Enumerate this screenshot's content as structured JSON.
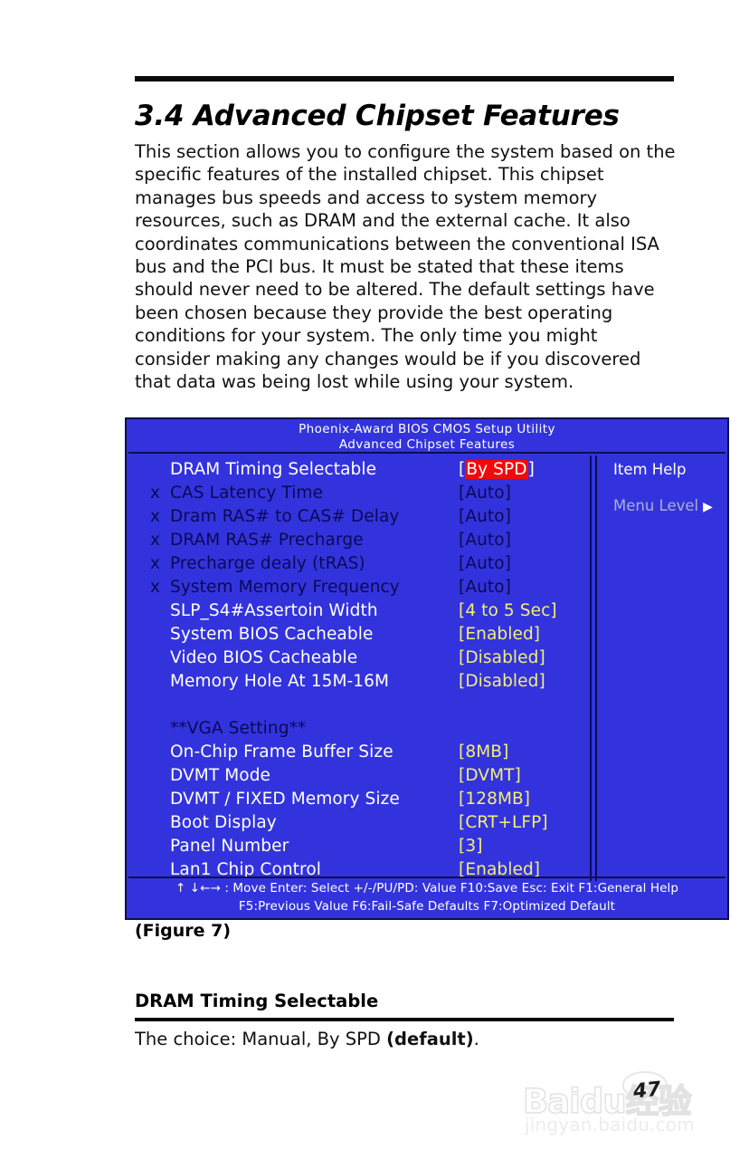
{
  "document": {
    "title": "3.4 Advanced Chipset Features",
    "intro": "This section allows you to configure the system based on the specific features of the installed chipset. This chipset manages bus speeds and access to system memory resources, such as DRAM and the external cache.  It also coordinates communications between the conventional ISA bus and the PCI bus. It must be stated that these items should never need to be altered. The default settings have been chosen because they provide the best operating conditions for your system. The only time you might consider making any changes would be if you discovered that data was being lost while using your system.",
    "figure_caption": "(Figure 7)",
    "page_number": "47"
  },
  "bios": {
    "title_line1": "Phoenix-Award BIOS CMOS Setup Utility",
    "title_line2": "Advanced Chipset Features",
    "rows": [
      {
        "mark": "",
        "label": "DRAM  Timing  Selectable",
        "value_prefix": "[",
        "value": "By SPD",
        "value_suffix": "]",
        "highlight": true,
        "dim": false,
        "section": false
      },
      {
        "mark": "x",
        "label": "CAS  Latency Time",
        "value_prefix": "[",
        "value": "Auto",
        "value_suffix": "]",
        "highlight": false,
        "dim": true,
        "section": false
      },
      {
        "mark": "x",
        "label": "Dram RAS#  to CAS# Delay",
        "value_prefix": "[",
        "value": "Auto",
        "value_suffix": "]",
        "highlight": false,
        "dim": true,
        "section": false
      },
      {
        "mark": "x",
        "label": "DRAM  RAS#  Precharge",
        "value_prefix": "[",
        "value": "Auto",
        "value_suffix": "]",
        "highlight": false,
        "dim": true,
        "section": false
      },
      {
        "mark": "x",
        "label": "Precharge  dealy (tRAS)",
        "value_prefix": "[",
        "value": "Auto",
        "value_suffix": "]",
        "highlight": false,
        "dim": true,
        "section": false
      },
      {
        "mark": "x",
        "label": "System Memory Frequency",
        "value_prefix": "[",
        "value": "Auto",
        "value_suffix": "]",
        "highlight": false,
        "dim": true,
        "section": false
      },
      {
        "mark": "",
        "label": "SLP_S4#Assertoin Width",
        "value_prefix": "[",
        "value": "4 to 5 Sec",
        "value_suffix": "]",
        "highlight": false,
        "dim": false,
        "section": false
      },
      {
        "mark": "",
        "label": "System  BIOS Cacheable",
        "value_prefix": "[",
        "value": "Enabled",
        "value_suffix": "]",
        "highlight": false,
        "dim": false,
        "section": false
      },
      {
        "mark": "",
        "label": "Video  BIOS Cacheable",
        "value_prefix": "[",
        "value": "Disabled",
        "value_suffix": "]",
        "highlight": false,
        "dim": false,
        "section": false
      },
      {
        "mark": "",
        "label": "Memory  Hole At 15M-16M",
        "value_prefix": "[",
        "value": "Disabled",
        "value_suffix": "]",
        "highlight": false,
        "dim": false,
        "section": false
      },
      {
        "mark": "",
        "label": "",
        "value_prefix": "",
        "value": "",
        "value_suffix": "",
        "highlight": false,
        "dim": false,
        "section": false
      },
      {
        "mark": "",
        "label": "**VGA Setting**",
        "value_prefix": "",
        "value": "",
        "value_suffix": "",
        "highlight": false,
        "dim": false,
        "section": true
      },
      {
        "mark": "",
        "label": "On-Chip Frame Buffer Size",
        "value_prefix": "[",
        "value": "8MB",
        "value_suffix": "]",
        "highlight": false,
        "dim": false,
        "section": false
      },
      {
        "mark": "",
        "label": "DVMT  Mode",
        "value_prefix": "[",
        "value": "DVMT",
        "value_suffix": "]",
        "highlight": false,
        "dim": false,
        "section": false
      },
      {
        "mark": "",
        "label": "DVMT / FIXED Memory Size",
        "value_prefix": "[",
        "value": "128MB",
        "value_suffix": "]",
        "highlight": false,
        "dim": false,
        "section": false
      },
      {
        "mark": "",
        "label": "Boot  Display",
        "value_prefix": "[",
        "value": "CRT+LFP",
        "value_suffix": "]",
        "highlight": false,
        "dim": false,
        "section": false
      },
      {
        "mark": "",
        "label": "Panel  Number",
        "value_prefix": "[",
        "value": "3",
        "value_suffix": "]",
        "highlight": false,
        "dim": false,
        "section": false
      },
      {
        "mark": "",
        "label": "Lan1 Chip Control",
        "value_prefix": "[",
        "value": "Enabled",
        "value_suffix": "]",
        "highlight": false,
        "dim": false,
        "section": false
      }
    ],
    "help": {
      "title": "Item Help",
      "menu_level_label": "Menu Level",
      "menu_level_arrow": "▶"
    },
    "footer": {
      "line1": "↑ ↓←→ : Move  Enter: Select  +/-/PU/PD: Value  F10:Save  Esc: Exit  F1:General Help",
      "line2": "F5:Previous Value   F6:Fail-Safe Defaults    F7:Optimized Default"
    },
    "colors": {
      "background": "#3333dd",
      "border": "#0d0d55",
      "label": "#ffffff",
      "value": "#f2f075",
      "dim": "#0a0a55",
      "highlight_bg": "#f20a0a"
    }
  },
  "section": {
    "heading": "DRAM Timing Selectable",
    "body_prefix": "The choice: Manual, By SPD ",
    "body_bold": "(default)",
    "body_suffix": "."
  },
  "watermark": {
    "main": "Baidu经验",
    "sub": "jingyan.baidu.com"
  }
}
